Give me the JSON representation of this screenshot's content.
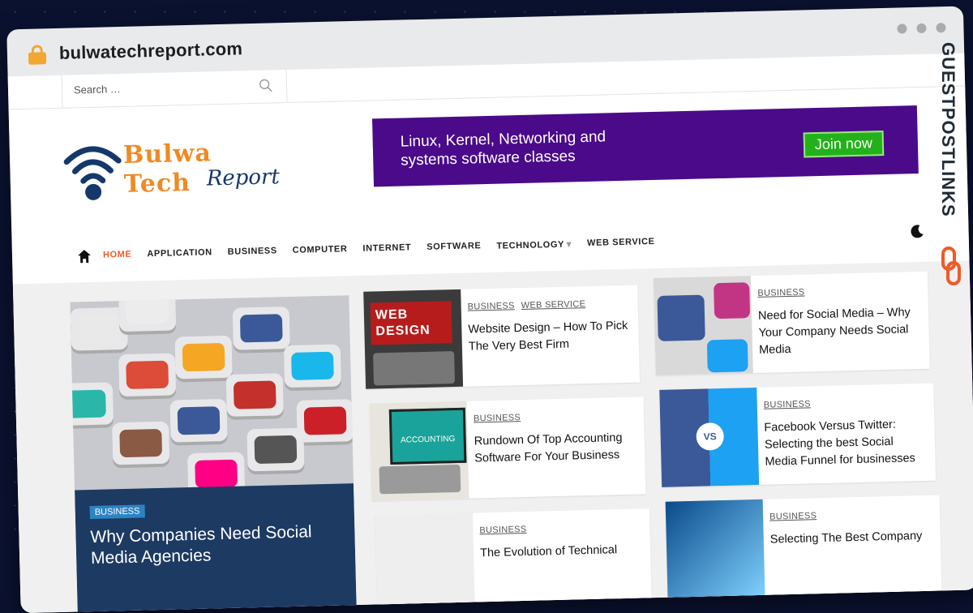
{
  "browser": {
    "url": "bulwatechreport.com"
  },
  "search": {
    "placeholder": "Search …"
  },
  "logo": {
    "line1": "Bulwa",
    "line2": "Tech",
    "line3": "Report"
  },
  "ad": {
    "text": "Linux, Kernel, Networking and systems software classes",
    "button": "Join now"
  },
  "nav": {
    "items": [
      "HOME",
      "APPLICATION",
      "BUSINESS",
      "COMPUTER",
      "INTERNET",
      "SOFTWARE",
      "TECHNOLOGY",
      "WEB SERVICE"
    ]
  },
  "watermark": "GUESTPOSTLINKS",
  "featured": {
    "category": "BUSINESS",
    "title": "Why Companies Need Social Media Agencies"
  },
  "posts": [
    {
      "cats": [
        "BUSINESS",
        "WEB SERVICE"
      ],
      "title": "Website Design – How To Pick The Very Best Firm",
      "thumb_text": "WEB DESIGN"
    },
    {
      "cats": [
        "BUSINESS"
      ],
      "title": "Need for Social Media – Why Your Company Needs Social Media"
    },
    {
      "cats": [
        "BUSINESS"
      ],
      "title": "Rundown Of Top Accounting Software For Your Business",
      "thumb_text": "ACCOUNTING"
    },
    {
      "cats": [
        "BUSINESS"
      ],
      "title": "Facebook Versus Twitter: Selecting the best Social Media Funnel for businesses",
      "thumb_text": "VS"
    },
    {
      "cats": [
        "BUSINESS"
      ],
      "title": "The Evolution of Technical"
    },
    {
      "cats": [
        "BUSINESS"
      ],
      "title": "Selecting The Best Company"
    }
  ],
  "colors": {
    "accent": "#f05a28",
    "ad_bg": "#4b0a8a",
    "featured_bg": "#1d3a63",
    "badge": "#2b84c4"
  }
}
